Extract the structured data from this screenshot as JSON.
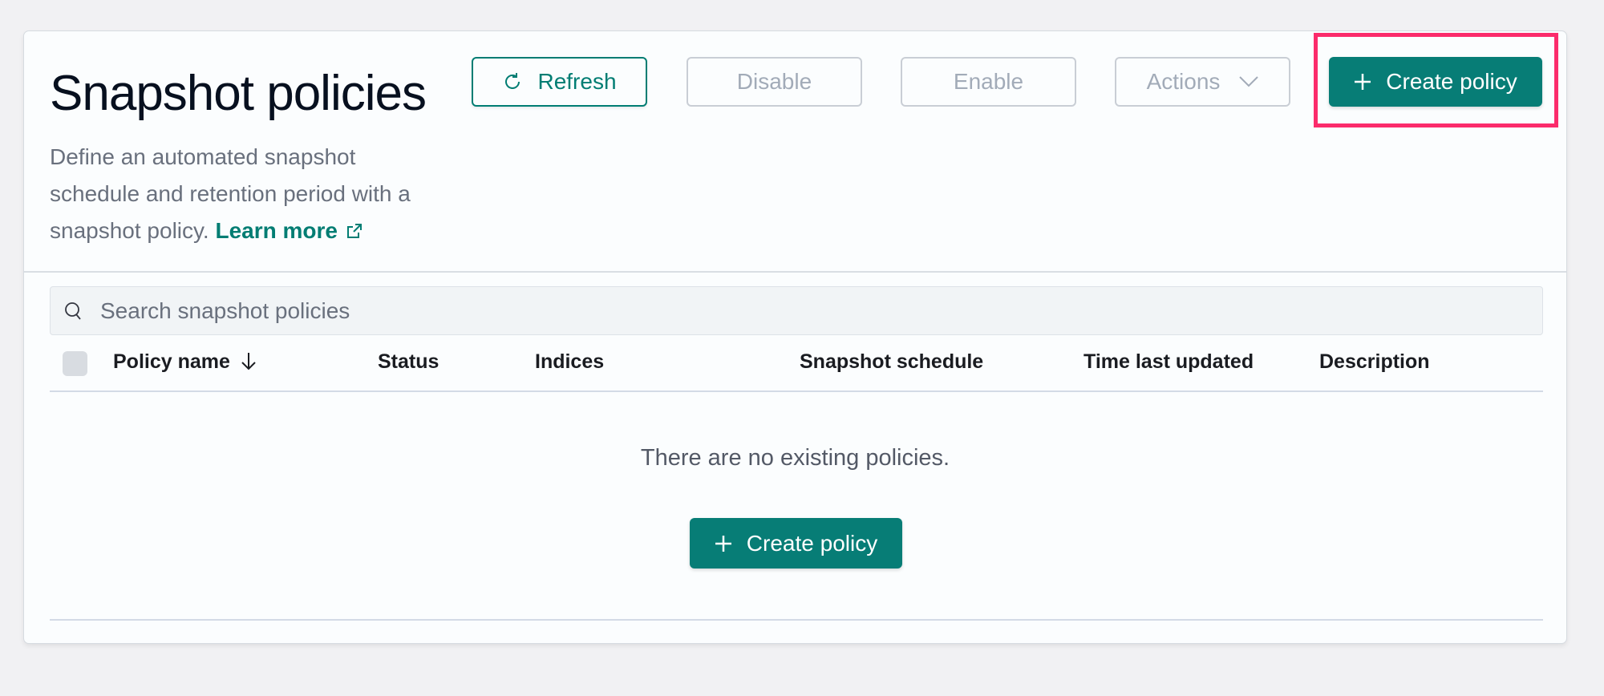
{
  "header": {
    "title": "Snapshot policies",
    "description": "Define an automated snapshot schedule and retention period with a snapshot policy.",
    "learn_more_label": "Learn more",
    "learn_more_icon": "external-link-icon"
  },
  "toolbar": {
    "refresh_label": "Refresh",
    "refresh_icon": "refresh-icon",
    "disable_label": "Disable",
    "enable_label": "Enable",
    "actions_label": "Actions",
    "actions_icon": "chevron-down-icon",
    "create_label": "Create policy",
    "create_icon": "plus-icon"
  },
  "search": {
    "placeholder": "Search snapshot policies",
    "value": "",
    "icon": "search-icon"
  },
  "table": {
    "columns": [
      {
        "label": "Policy name",
        "sort": "descending"
      },
      {
        "label": "Status"
      },
      {
        "label": "Indices"
      },
      {
        "label": "Snapshot schedule"
      },
      {
        "label": "Time last updated"
      },
      {
        "label": "Description"
      }
    ],
    "rows": [],
    "empty_message": "There are no existing policies.",
    "empty_create_label": "Create policy"
  },
  "colors": {
    "accent": "#077d76",
    "link": "#017d73",
    "highlight": "#fb2b6b",
    "page_bg": "#f1f1f3",
    "card_bg": "#fbfdfe"
  }
}
